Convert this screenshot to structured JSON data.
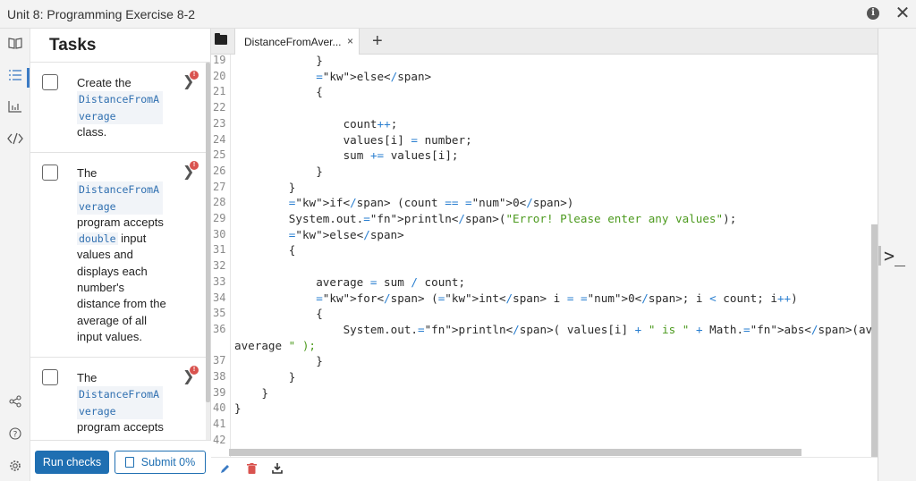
{
  "window": {
    "title": "Unit 8: Programming Exercise 8-2",
    "info_icon": "i",
    "close_icon": "✕"
  },
  "rail": {
    "icons": [
      {
        "name": "book-icon",
        "glyph": "📖"
      },
      {
        "name": "task-list-icon",
        "glyph": "☰"
      },
      {
        "name": "chart-icon",
        "glyph": "▥"
      },
      {
        "name": "code-icon",
        "glyph": "</>"
      },
      {
        "name": "share-icon",
        "glyph": "⤲"
      },
      {
        "name": "help-icon",
        "glyph": "?"
      },
      {
        "name": "settings-icon",
        "glyph": "⚙"
      }
    ]
  },
  "tasks": {
    "title": "Tasks",
    "items": [
      {
        "line1": "Create the",
        "code": "DistanceFromAverage",
        "after": "class.",
        "badge": "!"
      },
      {
        "line1": "The",
        "code": "DistanceFromAverage",
        "after": "program accepts",
        "code2": "double",
        "after2": "input values and displays each number's distance from the average of all input values.",
        "badge": "!"
      },
      {
        "line1": "The",
        "code": "DistanceFromAverage",
        "after": "program accepts",
        "badge": "!"
      }
    ],
    "run_checks": "Run checks",
    "submit": "Submit 0%"
  },
  "editor": {
    "tab_label": "DistanceFromAver...",
    "tab_close": "×",
    "new_tab": "+",
    "lines": [
      {
        "n": "19",
        "indent": 12,
        "text": "}"
      },
      {
        "n": "20",
        "indent": 12,
        "text": "else"
      },
      {
        "n": "21",
        "indent": 12,
        "text": "{"
      },
      {
        "n": "22",
        "indent": 0,
        "text": ""
      },
      {
        "n": "23",
        "indent": 16,
        "text": "count++;"
      },
      {
        "n": "24",
        "indent": 16,
        "text": "values[i] = number;"
      },
      {
        "n": "25",
        "indent": 16,
        "text": "sum += values[i];"
      },
      {
        "n": "26",
        "indent": 12,
        "text": "}"
      },
      {
        "n": "27",
        "indent": 8,
        "text": "}"
      },
      {
        "n": "28",
        "indent": 8,
        "text": "if (count == 0)"
      },
      {
        "n": "29",
        "indent": 8,
        "text": "System.out.println(\"Error! Please enter any values\");"
      },
      {
        "n": "30",
        "indent": 8,
        "text": "else"
      },
      {
        "n": "31",
        "indent": 8,
        "text": "{"
      },
      {
        "n": "32",
        "indent": 0,
        "text": ""
      },
      {
        "n": "33",
        "indent": 12,
        "text": "average = sum / count;"
      },
      {
        "n": "34",
        "indent": 12,
        "text": "for (int i = 0; i < count; i++)"
      },
      {
        "n": "35",
        "indent": 12,
        "text": "{"
      },
      {
        "n": "36",
        "indent": 16,
        "text": "System.out.println( values[i] + \" is \" + Math.abs(average - values[i]) + \" aw"
      },
      {
        "n": "",
        "indent": 0,
        "text": "average \" );"
      },
      {
        "n": "37",
        "indent": 12,
        "text": "}"
      },
      {
        "n": "38",
        "indent": 8,
        "text": "}"
      },
      {
        "n": "39",
        "indent": 4,
        "text": "}"
      },
      {
        "n": "40",
        "indent": 0,
        "text": "}"
      },
      {
        "n": "41",
        "indent": 0,
        "text": ""
      },
      {
        "n": "42",
        "indent": 0,
        "text": ""
      }
    ]
  },
  "bottom_toolbar": {
    "edit_icon": "✎",
    "delete_icon": "🗑",
    "download_icon": "⤓"
  },
  "terminal": {
    "icon": ">_"
  },
  "colors": {
    "primary": "#1f6fb2",
    "badge": "#d9534f",
    "keyword": "#8a3cb3",
    "string": "#4c9a1e",
    "number": "#c7651b"
  }
}
